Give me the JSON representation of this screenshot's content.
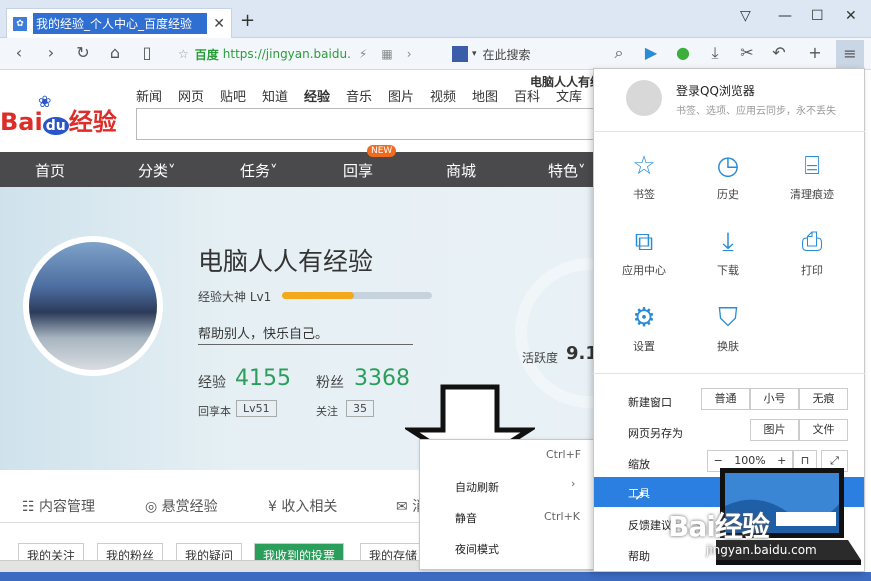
{
  "browser": {
    "tab_title": "我的经验_个人中心_百度经验",
    "new_tab": "+",
    "url_site_name": "百度",
    "url": "https://jingyan.baidu.",
    "search_placeholder": "在此搜索"
  },
  "page": {
    "top_nav": [
      "新闻",
      "网页",
      "贴吧",
      "知道",
      "经验",
      "音乐",
      "图片",
      "视频",
      "地图",
      "百科",
      "文库"
    ],
    "top_user": "电脑人人有经验",
    "logo_bai": "Bai",
    "logo_du": "du",
    "logo_jy": "经验",
    "categories": [
      "首页",
      "分类˅",
      "任务˅",
      "回享",
      "商城",
      "特色˅"
    ],
    "new_badge": "NEW",
    "user_name": "电脑人人有经验",
    "user_level": "经验大神 Lv1",
    "level_progress": 0.48,
    "motto": "帮助别人，快乐自己。",
    "exp_label": "经验",
    "exp_value": "4155",
    "fans_label": "粉丝",
    "fans_value": "3368",
    "huixiang_label": "回享本",
    "huixiang_value": "Lv51",
    "follow_label": "关注",
    "follow_value": "35",
    "activity_label": "活跃度",
    "activity_value": "9.1",
    "tabs": [
      "内容管理",
      "悬赏经验",
      "收入相关",
      "消"
    ],
    "subtabs": [
      "我的关注",
      "我的粉丝",
      "我的疑问",
      "我收到的投票",
      "我的存储"
    ]
  },
  "panel": {
    "login_title": "登录QQ浏览器",
    "login_sub": "书签、选项、应用云同步，永不丢失",
    "grid": [
      {
        "label": "书签",
        "icon": "star-icon"
      },
      {
        "label": "历史",
        "icon": "clock-icon"
      },
      {
        "label": "清理痕迹",
        "icon": "broom-icon"
      },
      {
        "label": "应用中心",
        "icon": "puzzle-icon"
      },
      {
        "label": "下载",
        "icon": "download-icon"
      },
      {
        "label": "打印",
        "icon": "printer-icon"
      },
      {
        "label": "设置",
        "icon": "gear-icon"
      },
      {
        "label": "换肤",
        "icon": "shirt-icon"
      }
    ],
    "new_window": "新建窗口",
    "window_opts": [
      "普通",
      "小号",
      "无痕"
    ],
    "save_page": "网页另存为",
    "save_opts": [
      "图片",
      "文件"
    ],
    "zoom_label": "缩放",
    "zoom_minus": "−",
    "zoom_value": "100%",
    "zoom_plus": "+",
    "tools": "工具",
    "feedback": "反馈建议",
    "help": "帮助"
  },
  "submenu": {
    "shortcut_top": "Ctrl+F",
    "auto_refresh": "自动刷新",
    "mute": "静音",
    "mute_shortcut": "Ctrl+K",
    "night_mode": "夜间模式"
  },
  "watermark": {
    "text": "Bai经验",
    "url": "jingyan.baidu.com"
  }
}
